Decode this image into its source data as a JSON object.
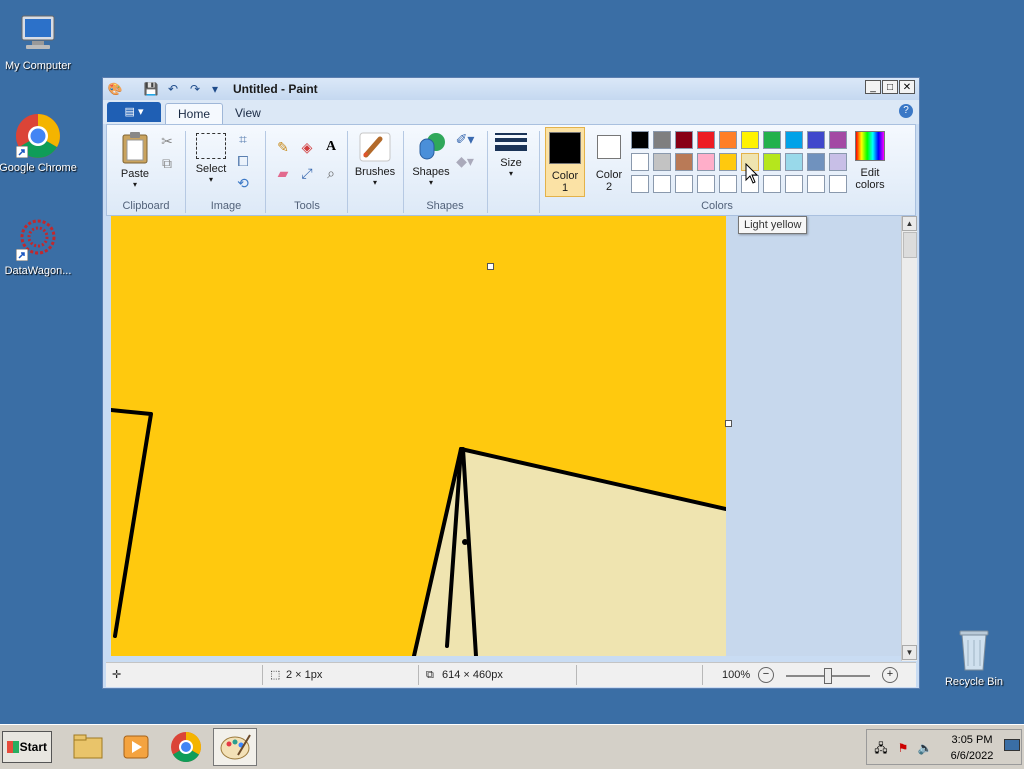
{
  "desktop": {
    "icons": [
      {
        "label": "My Computer"
      },
      {
        "label": "Google Chrome"
      },
      {
        "label": "DataWagon..."
      },
      {
        "label": "Recycle Bin"
      }
    ]
  },
  "window": {
    "title": "Untitled - Paint",
    "tabs": [
      "Home",
      "View"
    ],
    "active_tab": "Home"
  },
  "ribbon": {
    "clipboard": {
      "paste": "Paste",
      "group": "Clipboard"
    },
    "image": {
      "select": "Select",
      "group": "Image"
    },
    "tools": {
      "group": "Tools"
    },
    "shapes": {
      "brushes": "Brushes",
      "shapes": "Shapes",
      "group": "Shapes"
    },
    "size": {
      "label": "Size"
    },
    "colors": {
      "color1_label": "Color",
      "color1_num": "1",
      "color2_label": "Color",
      "color2_num": "2",
      "edit_label_1": "Edit",
      "edit_label_2": "colors",
      "group": "Colors",
      "color1": "#000000",
      "color2": "#ffffff",
      "palette_row1": [
        "#000000",
        "#7f7f7f",
        "#880015",
        "#ed1c24",
        "#ff7f27",
        "#fff200",
        "#22b14c",
        "#00a2e8",
        "#3f48cc",
        "#a349a4"
      ],
      "palette_row2": [
        "#ffffff",
        "#c3c3c3",
        "#b97a57",
        "#ffaec9",
        "#ffc90e",
        "#efe4b0",
        "#b5e61d",
        "#99d9ea",
        "#7092be",
        "#c8bfe7"
      ],
      "palette_row3": [
        "#ffffff",
        "#ffffff",
        "#ffffff",
        "#ffffff",
        "#ffffff",
        "#ffffff",
        "#ffffff",
        "#ffffff",
        "#ffffff",
        "#ffffff"
      ]
    }
  },
  "tooltip": "Light yellow",
  "status": {
    "selection_size": "2 × 1px",
    "canvas_size": "614 × 460px",
    "zoom": "100%"
  },
  "canvas": {
    "background": "#ffc90e",
    "fill_region": "#efe4b0"
  },
  "taskbar": {
    "start": "Start",
    "time": "3:05 PM",
    "date": "6/6/2022"
  }
}
